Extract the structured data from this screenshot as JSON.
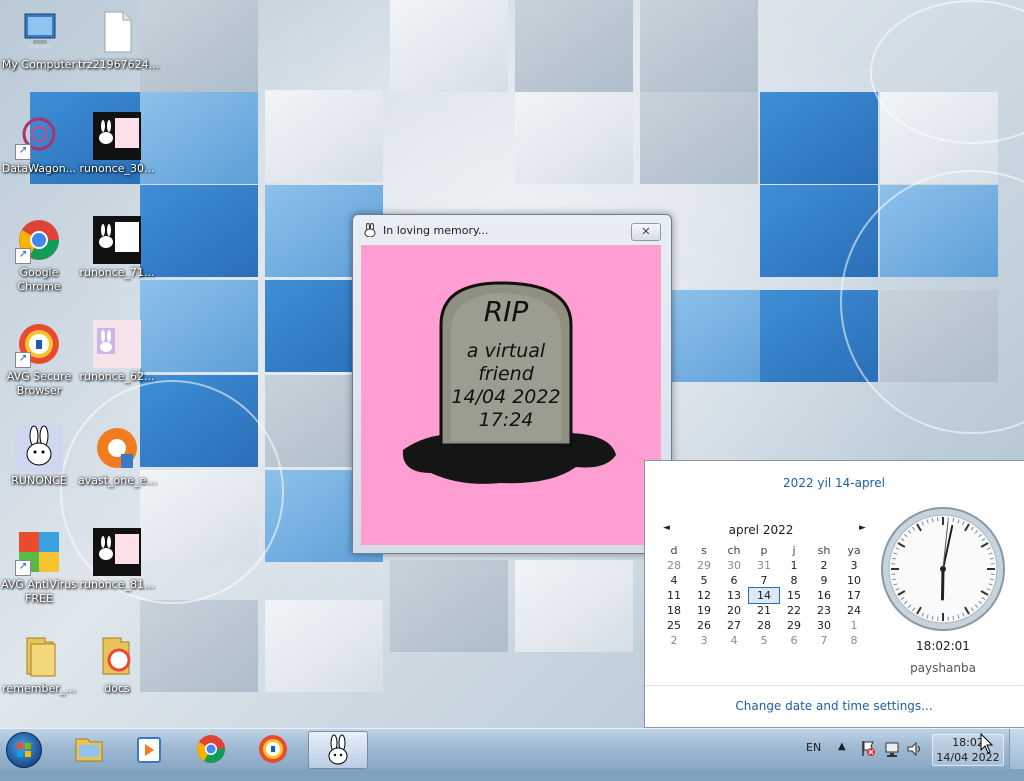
{
  "desktop": {
    "icons": [
      {
        "label": "My Computer"
      },
      {
        "label": "trz21967624..."
      },
      {
        "label": "DataWagon..."
      },
      {
        "label": "runonce_30..."
      },
      {
        "label": "Google Chrome"
      },
      {
        "label": "runonce_71..."
      },
      {
        "label": "AVG Secure Browser"
      },
      {
        "label": "runonce_62..."
      },
      {
        "label": "RUNONCE"
      },
      {
        "label": "avast_one_e..."
      },
      {
        "label": "AVG AntiVirus FREE"
      },
      {
        "label": "runonce_81..."
      },
      {
        "label": "remember_..."
      },
      {
        "label": "docs"
      }
    ]
  },
  "window": {
    "title": "In loving memory...",
    "close_glyph": "✕",
    "tombstone": {
      "line1": "RIP",
      "line2": "a virtual",
      "line3": "friend",
      "line4": "14/04 2022",
      "line5": "17:24"
    }
  },
  "calendar": {
    "long_date": "2022 yil 14-aprel",
    "month_title": "aprel 2022",
    "prev": "◄",
    "next": "►",
    "weekdays": [
      "d",
      "s",
      "ch",
      "p",
      "j",
      "sh",
      "ya"
    ],
    "weeks": [
      [
        "28",
        "29",
        "30",
        "31",
        "1",
        "2",
        "3"
      ],
      [
        "4",
        "5",
        "6",
        "7",
        "8",
        "9",
        "10"
      ],
      [
        "11",
        "12",
        "13",
        "14",
        "15",
        "16",
        "17"
      ],
      [
        "18",
        "19",
        "20",
        "21",
        "22",
        "23",
        "24"
      ],
      [
        "25",
        "26",
        "27",
        "28",
        "29",
        "30",
        "1"
      ],
      [
        "2",
        "3",
        "4",
        "5",
        "6",
        "7",
        "8"
      ]
    ],
    "today": "14",
    "time": "18:02:01",
    "weekday": "payshanba",
    "settings_link": "Change date and time settings..."
  },
  "taskbar": {
    "language": "EN",
    "clock_time": "18:02",
    "clock_date": "14/04 2022"
  }
}
